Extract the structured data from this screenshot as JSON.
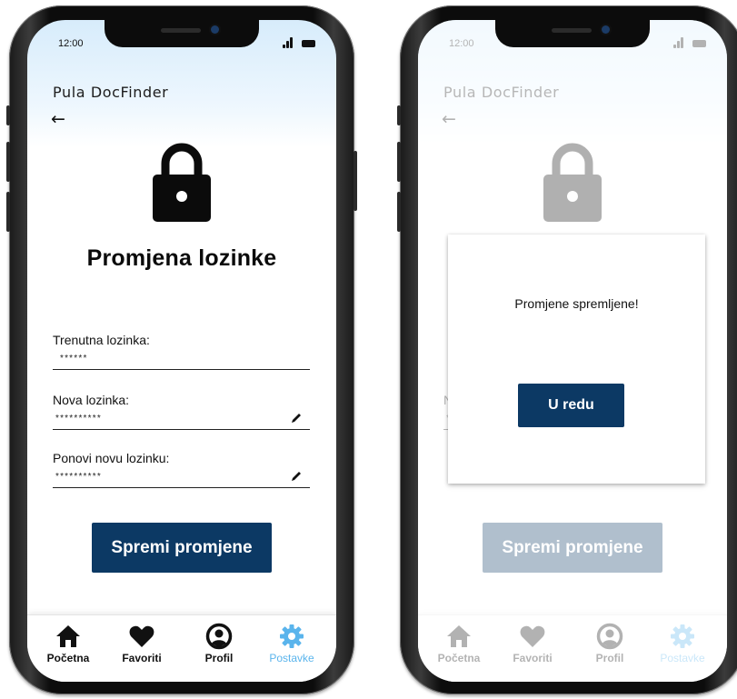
{
  "status_bar": {
    "time": "12:00"
  },
  "app": {
    "title": "Pula DocFinder",
    "back_icon": "←"
  },
  "page": {
    "title": "Promjena lozinke"
  },
  "form": {
    "current_password": {
      "label": "Trenutna lozinka:",
      "value": "******"
    },
    "new_password": {
      "label": "Nova lozinka:",
      "value": "**********"
    },
    "repeat_password": {
      "label": "Ponovi novu lozinku:",
      "value": "**********"
    }
  },
  "save_button": {
    "label": "Spremi promjene"
  },
  "tabs": [
    {
      "label": "Početna",
      "icon": "home-icon"
    },
    {
      "label": "Favoriti",
      "icon": "heart-icon"
    },
    {
      "label": "Profil",
      "icon": "user-circle-icon"
    },
    {
      "label": "Postavke",
      "icon": "gear-icon",
      "active": true
    }
  ],
  "dialog": {
    "message": "Promjene spremljene!",
    "ok_label": "U redu"
  },
  "colors": {
    "primary": "#0c3964",
    "active_tab": "#5ab4ec",
    "header_gradient_top": "#d7ecfb"
  }
}
